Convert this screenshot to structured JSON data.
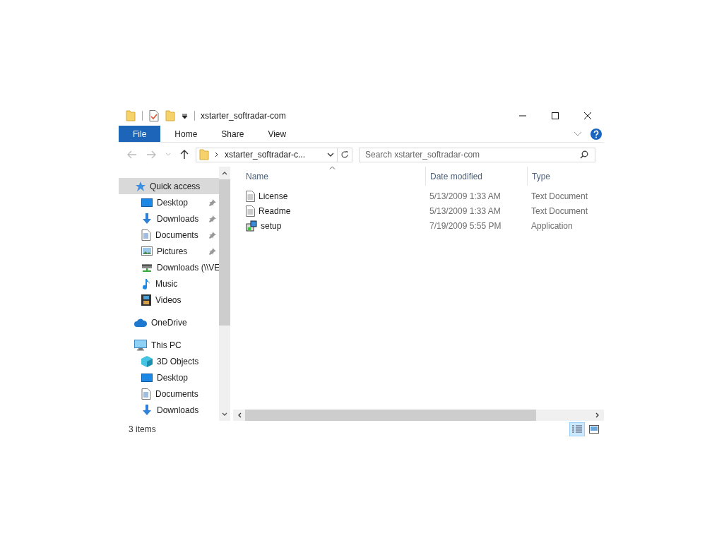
{
  "window": {
    "title": "xstarter_softradar-com"
  },
  "ribbon_tabs": [
    {
      "label": "File",
      "kind": "file"
    },
    {
      "label": "Home",
      "kind": "tab"
    },
    {
      "label": "Share",
      "kind": "tab"
    },
    {
      "label": "View",
      "kind": "tab"
    }
  ],
  "address": {
    "breadcrumb": "xstarter_softradar-c..."
  },
  "search": {
    "placeholder": "Search xstarter_softradar-com"
  },
  "navigation": [
    {
      "label": "Quick access",
      "kind": "star",
      "selected": true,
      "children": [
        {
          "label": "Desktop",
          "kind": "desktop",
          "pinned": true,
          "selected": false
        },
        {
          "label": "Downloads",
          "kind": "download",
          "pinned": true,
          "selected": false
        },
        {
          "label": "Documents",
          "kind": "document",
          "pinned": true,
          "selected": false
        },
        {
          "label": "Pictures",
          "kind": "pictures",
          "pinned": true,
          "selected": false
        },
        {
          "label": "Downloads (\\\\VE",
          "kind": "network",
          "pinned": false,
          "selected": false
        },
        {
          "label": "Music",
          "kind": "music",
          "pinned": false,
          "selected": false
        },
        {
          "label": "Videos",
          "kind": "videos",
          "pinned": false,
          "selected": false
        }
      ]
    },
    {
      "label": "OneDrive",
      "kind": "cloud",
      "selected": false
    },
    {
      "label": "This PC",
      "kind": "pc",
      "selected": false,
      "children": [
        {
          "label": "3D Objects",
          "kind": "cube",
          "pinned": false,
          "selected": false
        },
        {
          "label": "Desktop",
          "kind": "desktop",
          "pinned": false,
          "selected": false
        },
        {
          "label": "Documents",
          "kind": "document",
          "pinned": false,
          "selected": false
        },
        {
          "label": "Downloads",
          "kind": "download",
          "pinned": false,
          "selected": false
        }
      ]
    }
  ],
  "columns": [
    {
      "label": "Name",
      "sorted": true
    },
    {
      "label": "Date modified",
      "sorted": false
    },
    {
      "label": "Type",
      "sorted": false
    }
  ],
  "files": [
    {
      "name": "License",
      "date": "5/13/2009 1:33 AM",
      "type": "Text Document",
      "kind": "text"
    },
    {
      "name": "Readme",
      "date": "5/13/2009 1:33 AM",
      "type": "Text Document",
      "kind": "text"
    },
    {
      "name": "setup",
      "date": "7/19/2009 5:55 PM",
      "type": "Application",
      "kind": "installer"
    }
  ],
  "status_bar": {
    "count": "3 items"
  },
  "view_buttons": [
    {
      "kind": "details",
      "selected": true
    },
    {
      "kind": "large-icons",
      "selected": false
    }
  ]
}
